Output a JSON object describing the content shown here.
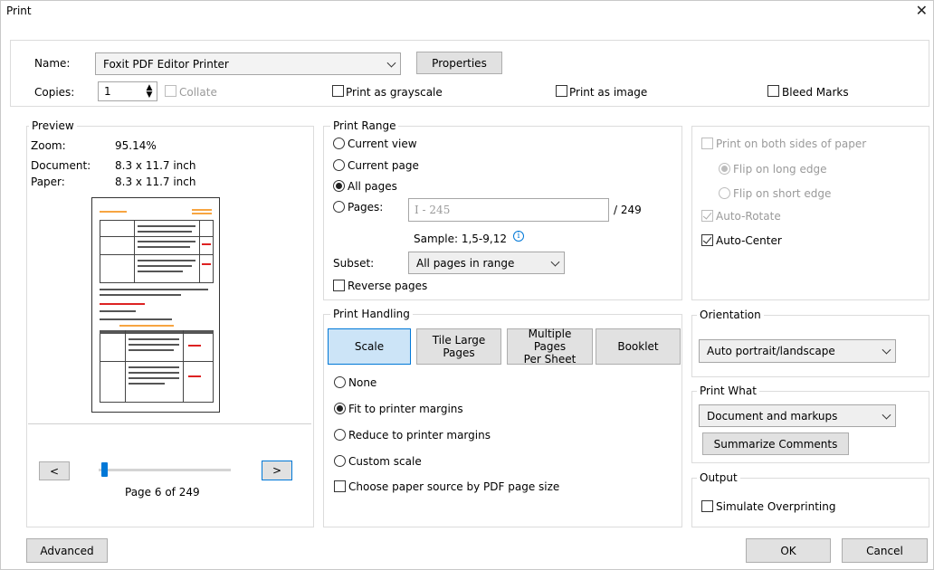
{
  "window": {
    "title": "Print"
  },
  "printer": {
    "name_label": "Name:",
    "name_value": "Foxit PDF Editor Printer",
    "properties": "Properties"
  },
  "copies": {
    "label": "Copies:",
    "value": "1",
    "collate": "Collate"
  },
  "options": {
    "grayscale": "Print as grayscale",
    "as_image": "Print as image",
    "bleed": "Bleed Marks"
  },
  "preview": {
    "title": "Preview",
    "zoom_label": "Zoom:",
    "zoom_value": "95.14%",
    "doc_label": "Document:",
    "doc_value": "8.3 x 11.7 inch",
    "paper_label": "Paper:",
    "paper_value": "8.3 x 11.7 inch",
    "prev": "<",
    "next": ">",
    "page_text": "Page 6 of 249",
    "page_progress": 0.024
  },
  "range": {
    "title": "Print Range",
    "current_view": "Current view",
    "current_page": "Current page",
    "all_pages": "All pages",
    "pages_label": "Pages:",
    "pages_placeholder": "I - 245",
    "pages_total": "/ 249",
    "sample": "Sample: 1,5-9,12",
    "subset_label": "Subset:",
    "subset_value": "All pages in range",
    "reverse": "Reverse pages"
  },
  "handling": {
    "title": "Print Handling",
    "tabs": [
      "Scale",
      "Tile Large\nPages",
      "Multiple Pages\nPer Sheet",
      "Booklet"
    ],
    "none": "None",
    "fit": "Fit to printer margins",
    "reduce": "Reduce to printer margins",
    "custom": "Custom scale",
    "paper_source": "Choose paper source by PDF page size"
  },
  "duplex": {
    "both_sides": "Print on both sides of paper",
    "long_edge": "Flip on long edge",
    "short_edge": "Flip on short edge",
    "auto_rotate": "Auto-Rotate",
    "auto_center": "Auto-Center"
  },
  "orientation": {
    "title": "Orientation",
    "value": "Auto portrait/landscape"
  },
  "print_what": {
    "title": "Print What",
    "value": "Document and markups",
    "summarize": "Summarize Comments"
  },
  "output": {
    "title": "Output",
    "simulate": "Simulate Overprinting"
  },
  "footer": {
    "advanced": "Advanced",
    "ok": "OK",
    "cancel": "Cancel"
  },
  "colors": {
    "accent": "#0078d7",
    "selected_tab": "#cce4f7",
    "button": "#e1e1e1"
  }
}
